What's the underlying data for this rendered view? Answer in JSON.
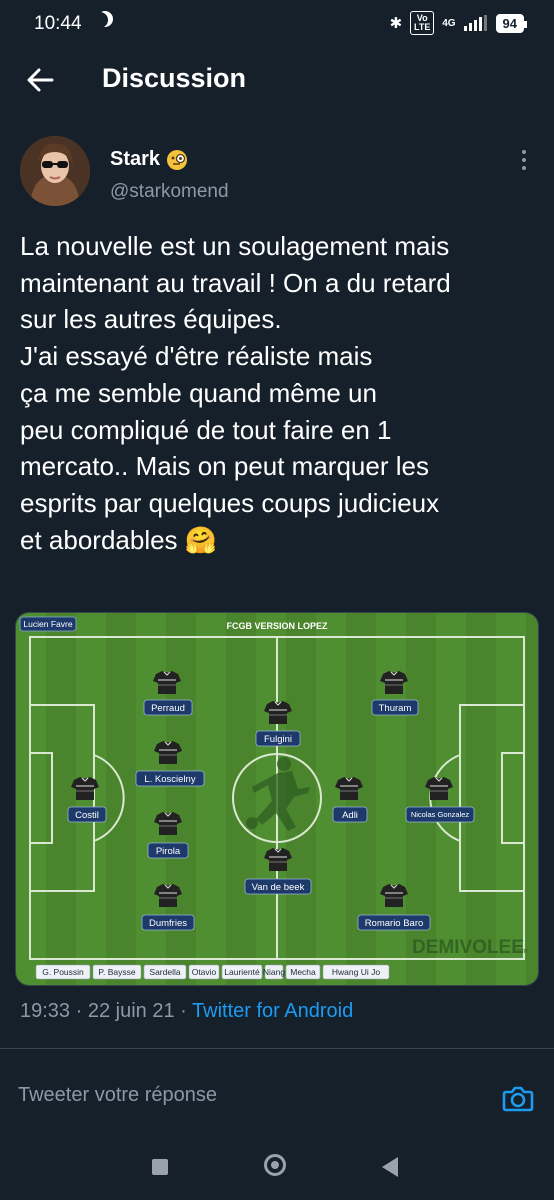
{
  "status_bar": {
    "time": "10:44",
    "network": "4G",
    "volte": "Vo LTE",
    "battery": "94"
  },
  "header": {
    "title": "Discussion"
  },
  "tweet": {
    "display_name": "Stark",
    "handle": "@starkomend",
    "text": "La nouvelle est un soulagement mais\nmaintenant au travail ! On a du retard\nsur les autres équipes.\nJ'ai essayé d'être réaliste mais\nça me semble quand même un\npeu compliqué de tout faire en 1\nmercato.. Mais on peut marquer les\nesprits par quelques coups judicieux\net abordables 🤗",
    "time": "19:33",
    "date": "22 juin 21",
    "source": "Twitter for Android"
  },
  "lineup": {
    "title": "FCGB VERSION LOPEZ",
    "coach": "Lucien Favre",
    "watermark": "DEMIVOLEE",
    "watermark_small": ".com",
    "players": {
      "perraud": "Perraud",
      "thuram": "Thuram",
      "fulgini": "Fulgini",
      "koscielny": "L. Koscielny",
      "costil": "Costil",
      "adli": "Adli",
      "gonzalez": "Nicolas Gonzalez",
      "pirola": "Pirola",
      "vandebeek": "Van de beek",
      "dumfries": "Dumfries",
      "baro": "Romario Baro"
    },
    "bench": [
      "G. Poussin",
      "P. Baysse",
      "Sardella",
      "Otavio",
      "Laurienté",
      "Niang",
      "Mecha",
      "Hwang Ui Jo"
    ]
  },
  "reply": {
    "placeholder": "Tweeter votre réponse"
  },
  "colors": {
    "background": "#15202b",
    "accent": "#1d9bf0",
    "muted": "#8b98a5",
    "pitch": "#4c8a2f"
  }
}
